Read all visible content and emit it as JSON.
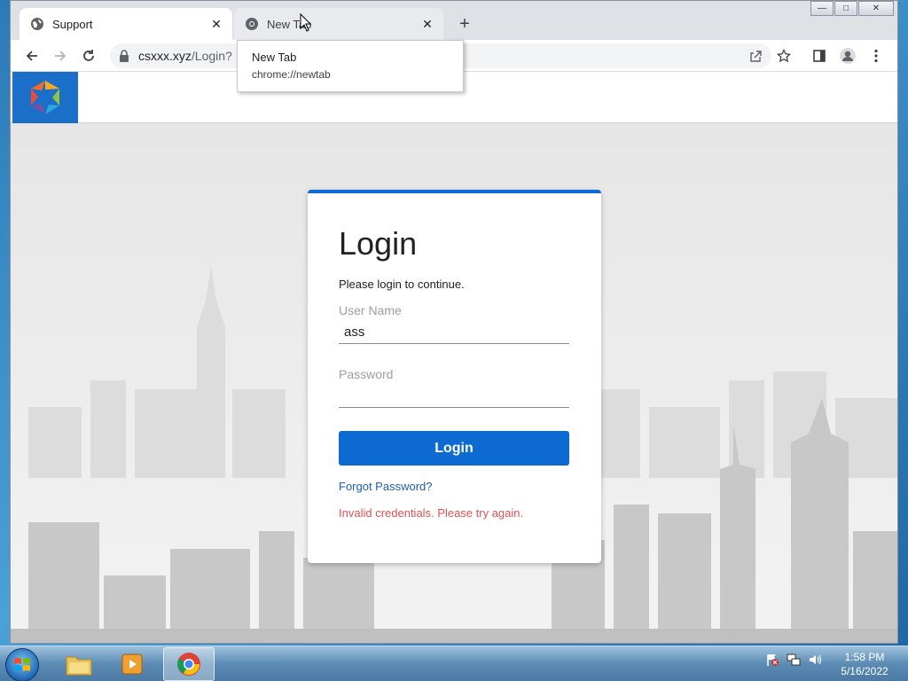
{
  "browser": {
    "tabs": [
      {
        "title": "Support",
        "close": "✕"
      },
      {
        "title": "New Tab",
        "close": "✕"
      }
    ],
    "new_tab_symbol": "+",
    "window_controls": {
      "minimize": "—",
      "maximize": "□",
      "close": "✕"
    },
    "address": {
      "host": "csxxx.xyz",
      "path": "/Login?"
    },
    "tooltip": {
      "title": "New Tab",
      "url": "chrome://newtab"
    }
  },
  "login": {
    "heading": "Login",
    "subtitle": "Please login to continue.",
    "username_label": "User Name",
    "username_value": "ass",
    "password_label": "Password",
    "password_value": "",
    "button_label": "Login",
    "forgot_link": "Forgot Password?",
    "error_message": "Invalid credentials. Please try again."
  },
  "taskbar": {
    "time": "1:58 PM",
    "date": "5/16/2022"
  },
  "colors": {
    "primary": "#0d6ad1",
    "error": "#e05252",
    "link": "#1b5fae"
  },
  "icons": [
    "globe-icon",
    "chrome-icon",
    "close-icon",
    "plus-icon",
    "back-icon",
    "forward-icon",
    "reload-icon",
    "lock-icon",
    "share-icon",
    "star-icon",
    "side-panel-icon",
    "profile-icon",
    "menu-icon"
  ]
}
